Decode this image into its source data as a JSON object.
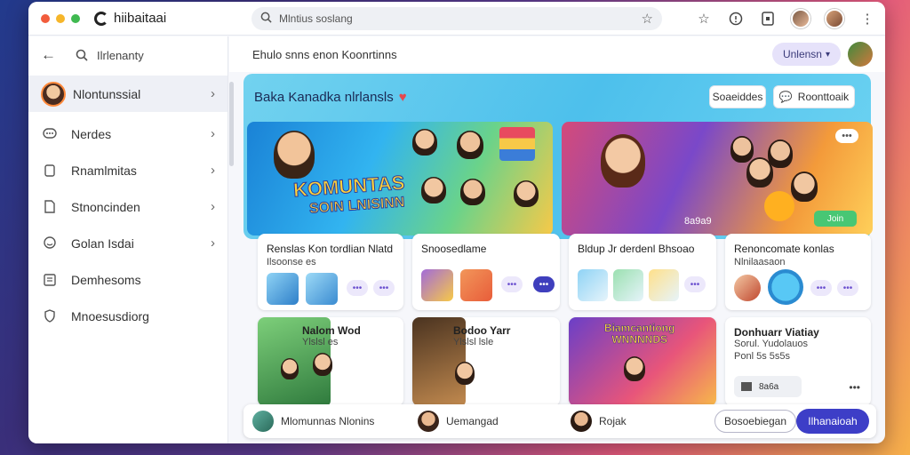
{
  "browser": {
    "app_name": "hiibaitaai",
    "search_text": "Mlntius soslang",
    "window_dot_colors": [
      "#f25c3c",
      "#f6b62a",
      "#3fb950"
    ]
  },
  "sidebar": {
    "title": "Ilrlenanty",
    "items": [
      {
        "label": "Nlontunssial",
        "icon": "avatar"
      },
      {
        "label": "Nerdes",
        "icon": "chat-bubble-icon"
      },
      {
        "label": "Rnamlmitas",
        "icon": "square-icon"
      },
      {
        "label": "Stnoncinden",
        "icon": "document-icon"
      },
      {
        "label": "Golan Isdai",
        "icon": "chat-smile-icon"
      },
      {
        "label": "Demhesoms",
        "icon": "list-icon"
      },
      {
        "label": "Mnoesusdiorg",
        "icon": "shield-icon"
      }
    ]
  },
  "main": {
    "header_title": "Ehulo snns enon Koonrtinns",
    "user_pill": "Unlensn",
    "hero": {
      "title": "Baka Kanadka nlrlansls",
      "btn_secondary": "Soaeiddes",
      "btn_room": "Roonttoaik",
      "banner_line1": "KOMUNTAS",
      "banner_line2": "SOIN LNISINN",
      "more_badge": "•••",
      "right_label": "8a9a9",
      "green_btn": "Join"
    },
    "cards_row1": [
      {
        "title": "Renslas Kon tordlian Nlatd",
        "sub": "Ilsoonse es",
        "tags": [
          "•••",
          "•••"
        ]
      },
      {
        "title": "Snoosedlame",
        "sub": "",
        "tags": [
          "•••",
          "•••"
        ]
      },
      {
        "title": "Bldup Jr derdenl Bhsoao",
        "sub": "",
        "tags": [
          "•••"
        ]
      },
      {
        "title": "Renoncomate konlas",
        "sub": "Nlnilaasaon",
        "tags": [
          "•••",
          "•••"
        ]
      }
    ],
    "cards_row2": [
      {
        "title": "Nalom Wod",
        "sub": "Ylslsl es"
      },
      {
        "title": "Bodoo Yarr",
        "sub": "Ylslsl lsle"
      },
      {
        "title": "",
        "sub": ""
      },
      {
        "title": "Donhuarr Viatiay",
        "sub": "Sorul. Yudolauos",
        "sub2": "Ponl 5s 5s5s",
        "stat": "8a6a",
        "more": "•••"
      }
    ],
    "overlay_card3": "Biamcantiong\nWNNNNDS"
  },
  "bottom_bar": {
    "people": [
      {
        "name": "Mlomunnas Nlonins"
      },
      {
        "name": "Uemangad"
      },
      {
        "name": "Rojak"
      }
    ],
    "btn_secondary": "Bosoebiegan",
    "btn_primary": "Ilhanaioah"
  },
  "colors": {
    "accent": "#3d3ec7",
    "hero_bg": "#4dc0ec",
    "pill_bg": "#e6e2fa"
  }
}
